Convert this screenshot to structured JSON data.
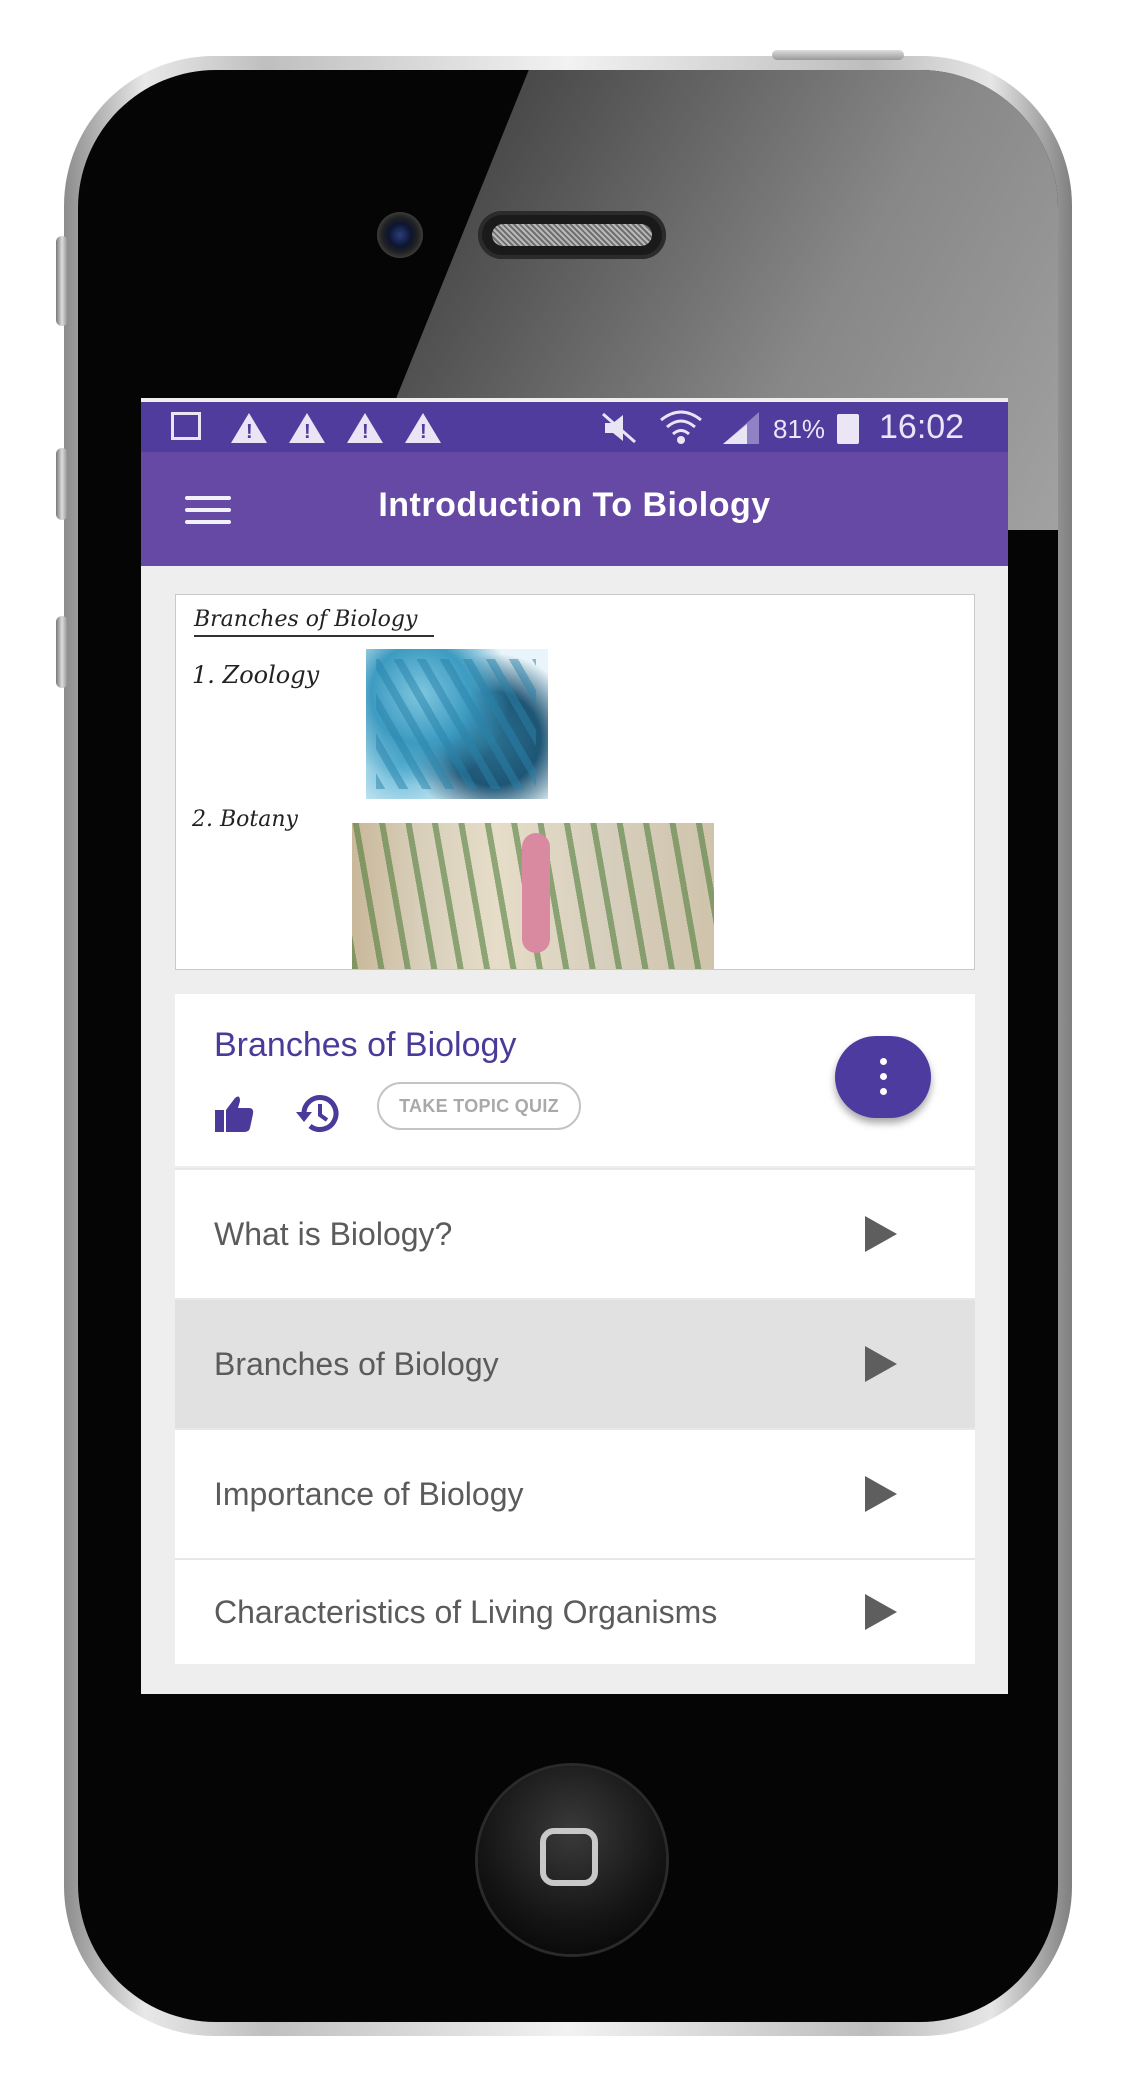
{
  "status_bar": {
    "notification_icons": [
      "image-icon",
      "warning-icon",
      "warning-icon",
      "warning-icon",
      "warning-icon"
    ],
    "system_icons": [
      "mute-icon",
      "wifi-icon",
      "signal-icon",
      "battery-icon"
    ],
    "battery": "81%",
    "time": "16:02"
  },
  "app_bar": {
    "menu_icon": "hamburger-menu-icon",
    "title": "Introduction To Biology"
  },
  "video": {
    "heading": "Branches of Biology",
    "item1": "1. Zoology",
    "item2": "2. Botany"
  },
  "topic": {
    "title": "Branches of Biology",
    "like_icon": "thumbs-up-icon",
    "history_icon": "history-icon",
    "quiz_button": "TAKE TOPIC QUIZ",
    "more_icon": "more-vertical-icon"
  },
  "lessons": [
    {
      "label": "What is Biology?",
      "active": false
    },
    {
      "label": "Branches of Biology",
      "active": true
    },
    {
      "label": "Importance of Biology",
      "active": false
    },
    {
      "label": "Characteristics of Living Organisms",
      "active": false
    }
  ],
  "colors": {
    "status_bar": "#503c9c",
    "app_bar": "#6648a5",
    "accent": "#4b3a99",
    "active_row": "#e1e1e1"
  }
}
